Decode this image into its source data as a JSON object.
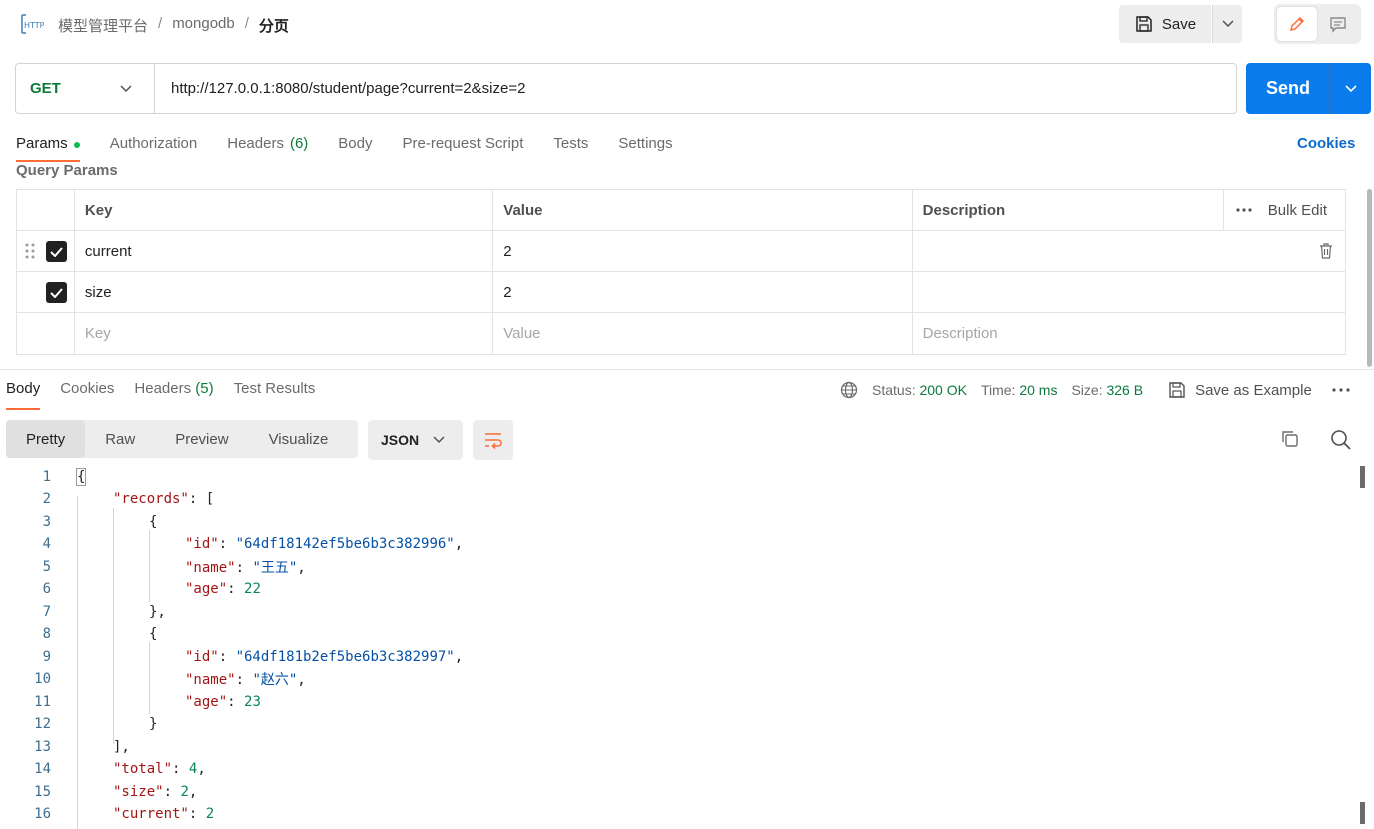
{
  "breadcrumb": {
    "items": [
      "模型管理平台",
      "mongodb"
    ],
    "current": "分页",
    "separator": "/"
  },
  "toolbar": {
    "save_label": "Save"
  },
  "request": {
    "method": "GET",
    "url": "http://127.0.0.1:8080/student/page?current=2&size=2",
    "send_label": "Send"
  },
  "req_tabs": {
    "params": "Params",
    "authorization": "Authorization",
    "headers": "Headers",
    "headers_count": "(6)",
    "body": "Body",
    "prerequest": "Pre-request Script",
    "tests": "Tests",
    "settings": "Settings",
    "cookies": "Cookies"
  },
  "query_params": {
    "title": "Query Params",
    "columns": {
      "key": "Key",
      "value": "Value",
      "description": "Description"
    },
    "bulk_edit": "Bulk Edit",
    "rows": [
      {
        "key": "current",
        "value": "2",
        "checked": true
      },
      {
        "key": "size",
        "value": "2",
        "checked": true
      }
    ],
    "placeholder": {
      "key": "Key",
      "value": "Value",
      "description": "Description"
    }
  },
  "response": {
    "tabs": {
      "body": "Body",
      "cookies": "Cookies",
      "headers": "Headers",
      "headers_count": "(5)",
      "test_results": "Test Results"
    },
    "status_label": "Status:",
    "status": "200 OK",
    "time_label": "Time:",
    "time": "20 ms",
    "size_label": "Size:",
    "size": "326 B",
    "save_example": "Save as Example",
    "formats": {
      "pretty": "Pretty",
      "raw": "Raw",
      "preview": "Preview",
      "visualize": "Visualize"
    },
    "language": "JSON",
    "line_numbers": [
      "1",
      "2",
      "3",
      "4",
      "5",
      "6",
      "7",
      "8",
      "9",
      "10",
      "11",
      "12",
      "13",
      "14",
      "15",
      "16"
    ],
    "json": {
      "records_key": "\"records\"",
      "records": [
        {
          "id_key": "\"id\"",
          "id": "\"64df18142ef5be6b3c382996\"",
          "name_key": "\"name\"",
          "name": "\"王五\"",
          "age_key": "\"age\"",
          "age": "22"
        },
        {
          "id_key": "\"id\"",
          "id": "\"64df181b2ef5be6b3c382997\"",
          "name_key": "\"name\"",
          "name": "\"赵六\"",
          "age_key": "\"age\"",
          "age": "23"
        }
      ],
      "total_key": "\"total\"",
      "total": "4",
      "size_key": "\"size\"",
      "size": "2",
      "current_key": "\"current\"",
      "current": "2"
    }
  },
  "colors": {
    "accent": "#ff6c37",
    "send": "#097bed",
    "method": "#0d7a3b",
    "status": "#0d7a3b",
    "link": "#0b6bd1"
  },
  "icons": [
    "http-icon",
    "save-icon",
    "chevron-down-icon",
    "pencil-icon",
    "comment-icon",
    "grip-icon",
    "checkbox-icon",
    "trash-icon",
    "more-icon",
    "globe-icon",
    "wrap-lines-icon",
    "copy-icon",
    "search-icon"
  ]
}
